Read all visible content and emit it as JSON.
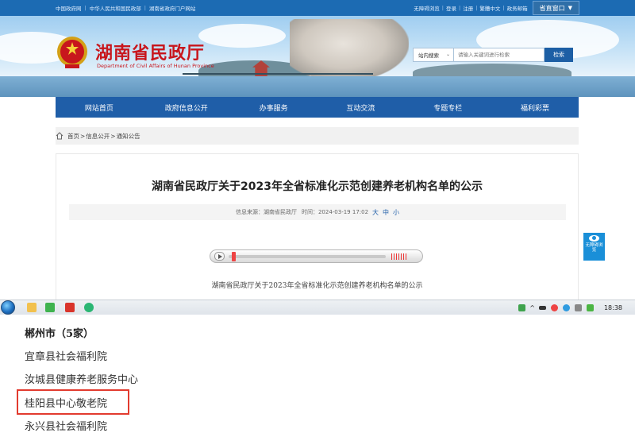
{
  "topbar": {
    "left_links": [
      "中国政府网",
      "中华人民共和国民政部",
      "湖南省政府门户网站"
    ],
    "right_links": [
      "无障碍浏览",
      "登录",
      "注册",
      "繁體中文",
      "政务邮箱"
    ],
    "portal_label": "省直窗口",
    "portal_caret": "▼"
  },
  "brand": {
    "title": "湖南省民政厅",
    "subtitle": "Department of Civil Affairs of Hunan Province"
  },
  "search": {
    "scope": "站内搜索",
    "placeholder": "请输入关键词进行检索",
    "button": "检索"
  },
  "nav": {
    "items": [
      "网站首页",
      "政府信息公开",
      "办事服务",
      "互动交流",
      "专题专栏",
      "福利彩票"
    ]
  },
  "breadcrumb": {
    "items": [
      "首页",
      "信息公开",
      "通知公告"
    ],
    "separator": ">"
  },
  "article": {
    "title": "湖南省民政厅关于2023年全省标准化示范创建养老机构名单的公示",
    "source_label": "信息来源：",
    "source": "湖南省民政厅",
    "time_label": "时间：",
    "time": "2024-03-19 17:02",
    "font_sizes": [
      "大",
      "中",
      "小"
    ],
    "body_first_line": "湖南省民政厅关于2023年全省标准化示范创建养老机构名单的公示"
  },
  "a11y_button": {
    "label": "无障碍浏览"
  },
  "taskbar": {
    "clock": "18:38"
  },
  "lower_list": {
    "heading": "郴州市（5家）",
    "items": [
      "宜章县社会福利院",
      "汝城县健康养老服务中心",
      "桂阳县中心敬老院",
      "永兴县社会福利院"
    ],
    "highlighted_item": "桂阳县中心敬老院"
  },
  "colors": {
    "nav_blue": "#1f5ea8",
    "brand_red": "#c8161d",
    "highlight_red": "#e23b2f"
  }
}
